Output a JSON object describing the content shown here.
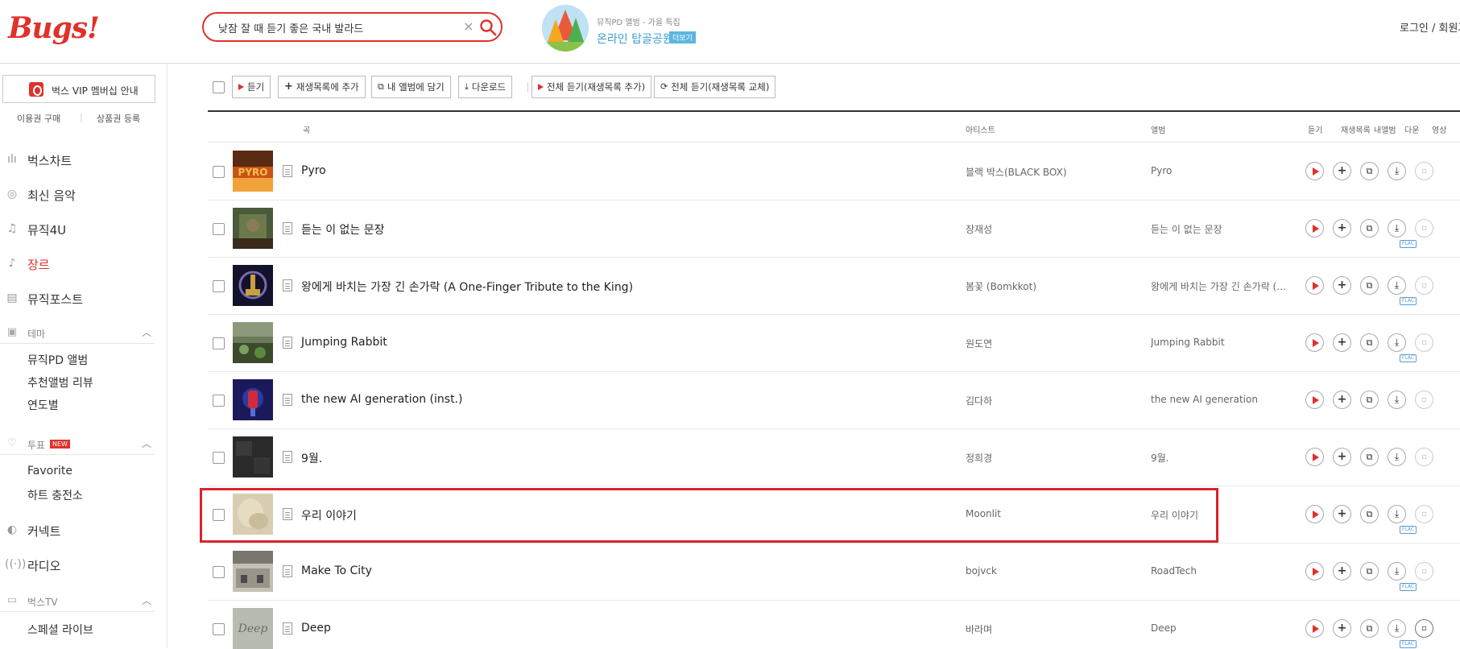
{
  "header": {
    "logo": "Bugs!",
    "search_value": "낮잠 잘 때 듣기 좋은 국내 발라드",
    "promo_sub": "뮤직PD 앨범 - 가을 특집",
    "promo_title": "온라인 탑골공원",
    "promo_more": "더보기",
    "login": "로그인 / 회원가"
  },
  "sidebar": {
    "vip": "벅스 VIP 멤버십 안내",
    "buy": "이용권 구매",
    "sep": "|",
    "register": "상품권 등록",
    "nav": [
      "벅스차트",
      "최신 음악",
      "뮤직4U",
      "장르",
      "뮤직포스트"
    ],
    "theme_header": "테마",
    "theme_items": [
      "뮤직PD 앨범",
      "추천앨범 리뷰",
      "연도별"
    ],
    "vote_header": "투표",
    "vote_new": "NEW",
    "vote_items": [
      "Favorite",
      "하트 충전소"
    ],
    "connect": "커넥트",
    "radio": "라디오",
    "tv_header": "벅스TV",
    "tv_items": [
      "스페셜 라이브"
    ]
  },
  "toolbar": {
    "listen": "듣기",
    "add_playlist": "재생목록에 추가",
    "add_album": "내 앨범에 담기",
    "download": "다운로드",
    "play_all_add": "전체 듣기(재생목록 추가)",
    "play_all_replace": "전체 듣기(재생목록 교체)"
  },
  "table": {
    "headers": {
      "song": "곡",
      "artist": "아티스트",
      "album": "앨범",
      "listen": "듣기",
      "playlist": "재생목록",
      "myalbum": "내앨범",
      "down": "다운",
      "video": "영상"
    },
    "rows": [
      {
        "title": "Pyro",
        "artist": "블랙 박스(BLACK BOX)",
        "album": "Pyro",
        "flac": false,
        "mv": false
      },
      {
        "title": "듣는 이 없는 문장",
        "artist": "장재성",
        "album": "듣는 이 없는 문장",
        "flac": true,
        "mv": false
      },
      {
        "title": "왕에게 바치는 가장 긴 손가락 (A One-Finger Tribute to the King)",
        "artist": "봄꽃 (Bomkkot)",
        "album": "왕에게 바치는 가장 긴 손가락 (…",
        "flac": true,
        "mv": false
      },
      {
        "title": "Jumping Rabbit",
        "artist": "원도연",
        "album": "Jumping Rabbit",
        "flac": true,
        "mv": false
      },
      {
        "title": "the new AI generation (inst.)",
        "artist": "김다하",
        "album": "the new AI generation",
        "flac": false,
        "mv": false
      },
      {
        "title": "9월.",
        "artist": "정희경",
        "album": "9월.",
        "flac": false,
        "mv": false
      },
      {
        "title": "우리 이야기",
        "artist": "Moonlit",
        "album": "우리 이야기",
        "flac": true,
        "mv": false
      },
      {
        "title": "Make To City",
        "artist": "bojvck",
        "album": "RoadTech",
        "flac": true,
        "mv": false
      },
      {
        "title": "Deep",
        "artist": "바라며",
        "album": "Deep",
        "flac": true,
        "mv": true
      }
    ]
  },
  "colors": {
    "accent": "#e0312b",
    "highlight": "#d9232d",
    "promo": "#3aa0cf"
  }
}
